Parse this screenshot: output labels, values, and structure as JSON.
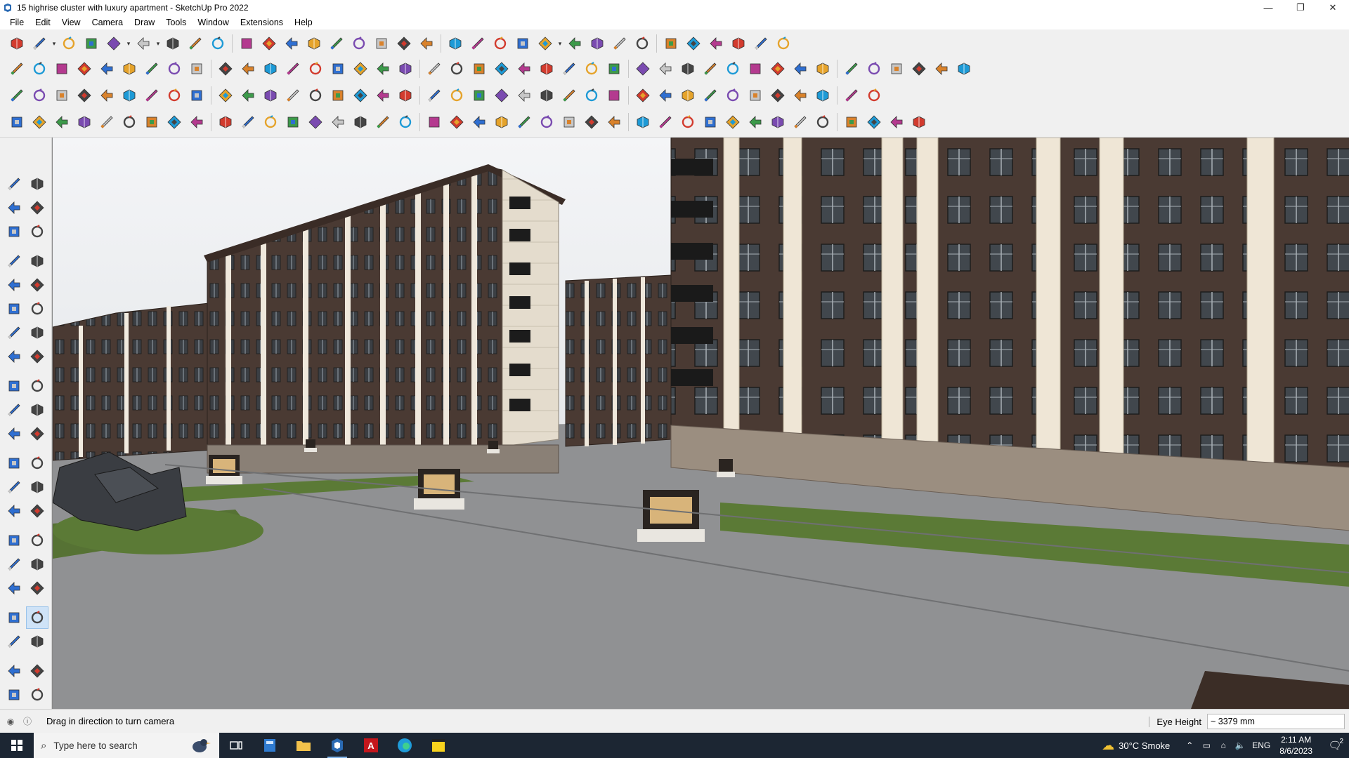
{
  "window": {
    "title": "15 highrise cluster with luxury apartment - SketchUp Pro 2022",
    "controls": {
      "minimize": "—",
      "restore": "❐",
      "close": "✕"
    }
  },
  "menu": [
    "File",
    "Edit",
    "View",
    "Camera",
    "Draw",
    "Tools",
    "Window",
    "Extensions",
    "Help"
  ],
  "toolbars": {
    "row1": [
      "zoom-icon",
      "select-icon",
      "eraser-icon",
      "pencil-icon",
      "lasso-icon",
      "paint-icon",
      "push-pull-icon",
      "follow-me-icon",
      "move-icon",
      "rotate-icon",
      "scale-icon",
      "tape-icon",
      "text-icon",
      "paint-bucket-icon",
      "orbit-icon",
      "pan-icon",
      "zoom-window-icon",
      "zoom-extents-icon",
      "iso-view-icon",
      "top-view-icon",
      "front-view-icon",
      "right-view-icon",
      "style-icon",
      "section-plane-icon",
      "section-display-icon",
      "section-fill-icon",
      "axes-icon",
      "flip-icon",
      "arrows-icon",
      "tags-icon",
      "undo-icon",
      "redo-icon",
      "extension-icon"
    ],
    "row2_count": 42,
    "row3_count": 38,
    "row4_count": 40
  },
  "viewport": {
    "scene": "3D model view of highrise apartment buildings"
  },
  "status": {
    "hint": "Drag in direction to turn camera",
    "measure_label": "Eye Height",
    "measure_value": "~ 3379 mm"
  },
  "taskbar": {
    "search_placeholder": "Type here to search",
    "weather_temp": "30°C",
    "weather_text": "Smoke",
    "language": "ENG",
    "time": "2:11 AM",
    "date": "8/6/2023",
    "notification_count": "2"
  },
  "colors": {
    "building_dark": "#4a3a33",
    "building_light": "#e8e0d2",
    "grass": "#5b7a36",
    "road": "#8e8f90"
  }
}
